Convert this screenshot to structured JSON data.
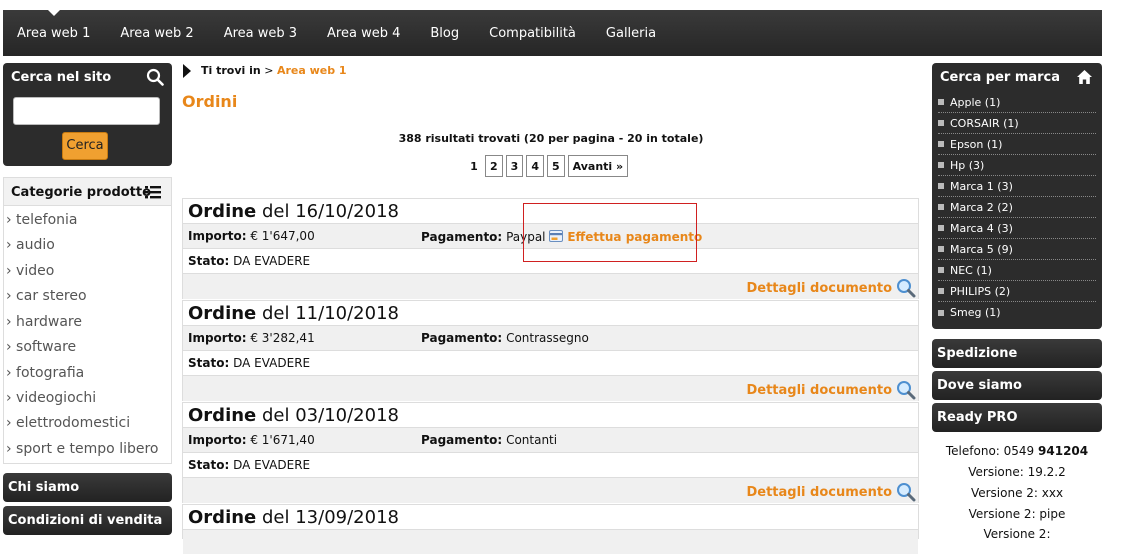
{
  "nav": [
    "Area web 1",
    "Area web 2",
    "Area web 3",
    "Area web 4",
    "Blog",
    "Compatibilità",
    "Galleria"
  ],
  "search": {
    "title": "Cerca nel sito",
    "button": "Cerca",
    "icon": "search-icon"
  },
  "categories": {
    "title": "Categorie prodotto",
    "items": [
      "› telefonia",
      "› audio",
      "› video",
      "› car stereo",
      "› hardware",
      "› software",
      "› fotografia",
      "› videogiochi",
      "› elettrodomestici",
      "› sport e tempo libero"
    ]
  },
  "side_buttons": {
    "about": "Chi siamo",
    "terms": "Condizioni di vendita"
  },
  "breadcrumb": {
    "label": "Ti trovi in",
    "sep": ">",
    "current": "Area web 1"
  },
  "page_title": "Ordini",
  "results_text": "388 risultati trovati (20 per pagina - 20 in totale)",
  "pager": {
    "pages": [
      "1",
      "2",
      "3",
      "4",
      "5"
    ],
    "next": "Avanti »",
    "current": "1"
  },
  "orders": [
    {
      "prefix": "Ordine",
      "date_text": "del 16/10/2018",
      "amount_label": "Importo:",
      "amount": "€ 1'647,00",
      "pay_label": "Pagamento:",
      "pay": "Paypal",
      "pay_link": "Effettua pagamento",
      "status_label": "Stato:",
      "status": "DA EVADERE",
      "details": "Dettagli documento"
    },
    {
      "prefix": "Ordine",
      "date_text": "del 11/10/2018",
      "amount_label": "Importo:",
      "amount": "€ 3'282,41",
      "pay_label": "Pagamento:",
      "pay": "Contrassegno",
      "status_label": "Stato:",
      "status": "DA EVADERE",
      "details": "Dettagli documento"
    },
    {
      "prefix": "Ordine",
      "date_text": "del 03/10/2018",
      "amount_label": "Importo:",
      "amount": "€ 1'671,40",
      "pay_label": "Pagamento:",
      "pay": "Contanti",
      "status_label": "Stato:",
      "status": "DA EVADERE",
      "details": "Dettagli documento"
    },
    {
      "prefix": "Ordine",
      "date_text": "del 13/09/2018"
    }
  ],
  "brands": {
    "title": "Cerca per marca",
    "items": [
      "Apple (1)",
      "CORSAIR (1)",
      "Epson (1)",
      "Hp (3)",
      "Marca 1 (3)",
      "Marca 2 (2)",
      "Marca 4 (3)",
      "Marca 5 (9)",
      "NEC (1)",
      "PHILIPS (2)",
      "Smeg (1)"
    ]
  },
  "right_buttons": [
    "Spedizione",
    "Dove siamo",
    "Ready PRO"
  ],
  "contact": {
    "phone_label": "Telefono: 0549",
    "phone_bold": "941204",
    "versions": [
      "Versione: 19.2.2",
      "Versione 2: xxx",
      "Versione 2: pipe",
      "Versione 2:"
    ]
  },
  "colors": {
    "accent": "#e8871a",
    "dark": "#2c2c2c",
    "button": "#f0a030"
  }
}
